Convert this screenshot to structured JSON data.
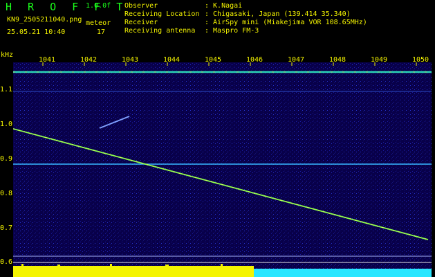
{
  "header": {
    "brand": "H R O F F T",
    "version": "1.0.0f",
    "filename": "KN9_2505211040.png",
    "mode": "meteor",
    "count": "17",
    "datetime": "25.05.21 10:40",
    "labels": [
      "Observer",
      "Receiving Location",
      "Receiver",
      "Receiving antenna"
    ],
    "values": [
      ": K.Nagai",
      ": Chigasaki, Japan (139.414 35.340)",
      ": AirSpy mini (Miakejima VOR 108.65MHz)",
      ": Maspro FM-3"
    ]
  },
  "axes": {
    "y_unit": "kHz",
    "y_ticks": [
      "1.1",
      "1.0",
      "0.9",
      "0.8",
      "0.7",
      "0.6"
    ],
    "x_ticks": [
      "1041",
      "1042",
      "1043",
      "1044",
      "1045",
      "1046",
      "1047",
      "1048",
      "1049",
      "1050"
    ]
  },
  "colors": {
    "text": "#f4f400",
    "brand": "#1bff1b",
    "background": "#000000",
    "spectrum_bg": "#08004a",
    "trace": "#8cff4a",
    "baseline_yellow": "#f4f400",
    "baseline_cyan": "#29e6ff"
  }
}
